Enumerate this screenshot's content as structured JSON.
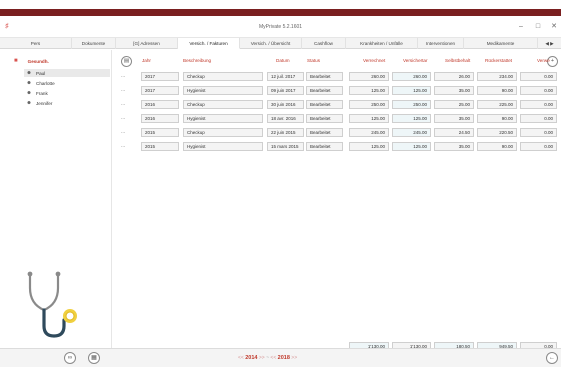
{
  "window": {
    "title": "MyPrivate 5.2.1601"
  },
  "tabs": [
    {
      "label": "Pers",
      "active": false
    },
    {
      "label": "Dokumente",
      "active": false
    },
    {
      "label": "[G] Adressen",
      "active": false
    },
    {
      "label": "Versich. / Fakturen",
      "active": true
    },
    {
      "label": "Versich. / Übersicht",
      "active": false
    },
    {
      "label": "Cashflow",
      "active": false
    },
    {
      "label": "Krankheiten / Unfälle",
      "active": false
    },
    {
      "label": "Interventionen",
      "active": false
    },
    {
      "label": "Medikamente",
      "active": false
    }
  ],
  "sidebar": {
    "root_label": "Gesundh.",
    "people": [
      {
        "label": "Paul",
        "selected": true
      },
      {
        "label": "Charlotte",
        "selected": false
      },
      {
        "label": "Frank",
        "selected": false
      },
      {
        "label": "Jennifer",
        "selected": false
      }
    ]
  },
  "table": {
    "columns": {
      "jahr": "Jahr",
      "beschreibung": "Beschreibung",
      "datum": "Datum",
      "status": "Status",
      "verrechnet": "Verrechnet",
      "versichertar": "Versichertar",
      "selbstbehalt": "Selbstbehalt",
      "rueckerstattet": "Rückerstattet",
      "verwendet": "Verwe"
    },
    "row_marker": "...",
    "rows": [
      {
        "jahr": "2017",
        "beschreibung": "Checkup",
        "datum": "12 juil. 2017",
        "status": "Bearbeitet",
        "verrechnet": "260.00",
        "versichertar": "260.00",
        "selbstbehalt": "26.00",
        "rueckerstattet": "234.00",
        "verwendet": "0.00"
      },
      {
        "jahr": "2017",
        "beschreibung": "Hygienist",
        "datum": "09 juin 2017",
        "status": "Bearbeitet",
        "verrechnet": "125.00",
        "versichertar": "125.00",
        "selbstbehalt": "35.00",
        "rueckerstattet": "90.00",
        "verwendet": "0.00"
      },
      {
        "jahr": "2016",
        "beschreibung": "Checkup",
        "datum": "30 juin 2016",
        "status": "Bearbeitet",
        "verrechnet": "250.00",
        "versichertar": "250.00",
        "selbstbehalt": "25.00",
        "rueckerstattet": "225.00",
        "verwendet": "0.00"
      },
      {
        "jahr": "2016",
        "beschreibung": "Hygienist",
        "datum": "18 avr. 2016",
        "status": "Bearbeitet",
        "verrechnet": "125.00",
        "versichertar": "125.00",
        "selbstbehalt": "35.00",
        "rueckerstattet": "90.00",
        "verwendet": "0.00"
      },
      {
        "jahr": "2015",
        "beschreibung": "Checkup",
        "datum": "22 juin 2015",
        "status": "Bearbeitet",
        "verrechnet": "245.00",
        "versichertar": "245.00",
        "selbstbehalt": "24.50",
        "rueckerstattet": "220.50",
        "verwendet": "0.00"
      },
      {
        "jahr": "2015",
        "beschreibung": "Hygienist",
        "datum": "15 mars 2015",
        "status": "Bearbeitet",
        "verrechnet": "125.00",
        "versichertar": "125.00",
        "selbstbehalt": "35.00",
        "rueckerstattet": "90.00",
        "verwendet": "0.00"
      }
    ],
    "totals": {
      "verrechnet": "1'130.00",
      "versichertar": "1'130.00",
      "selbstbehalt": "180.50",
      "rueckerstattet": "949.50",
      "verwendet": "0.00"
    }
  },
  "pager": {
    "prev_prev": "<<",
    "year_from": "2014",
    "next_from": ">>",
    "separator": "~",
    "prev_to": "<<",
    "year_to": "2018",
    "next_to": ">>"
  },
  "colors": {
    "accent": "#c0392b",
    "stripe": "#7a1f20"
  }
}
